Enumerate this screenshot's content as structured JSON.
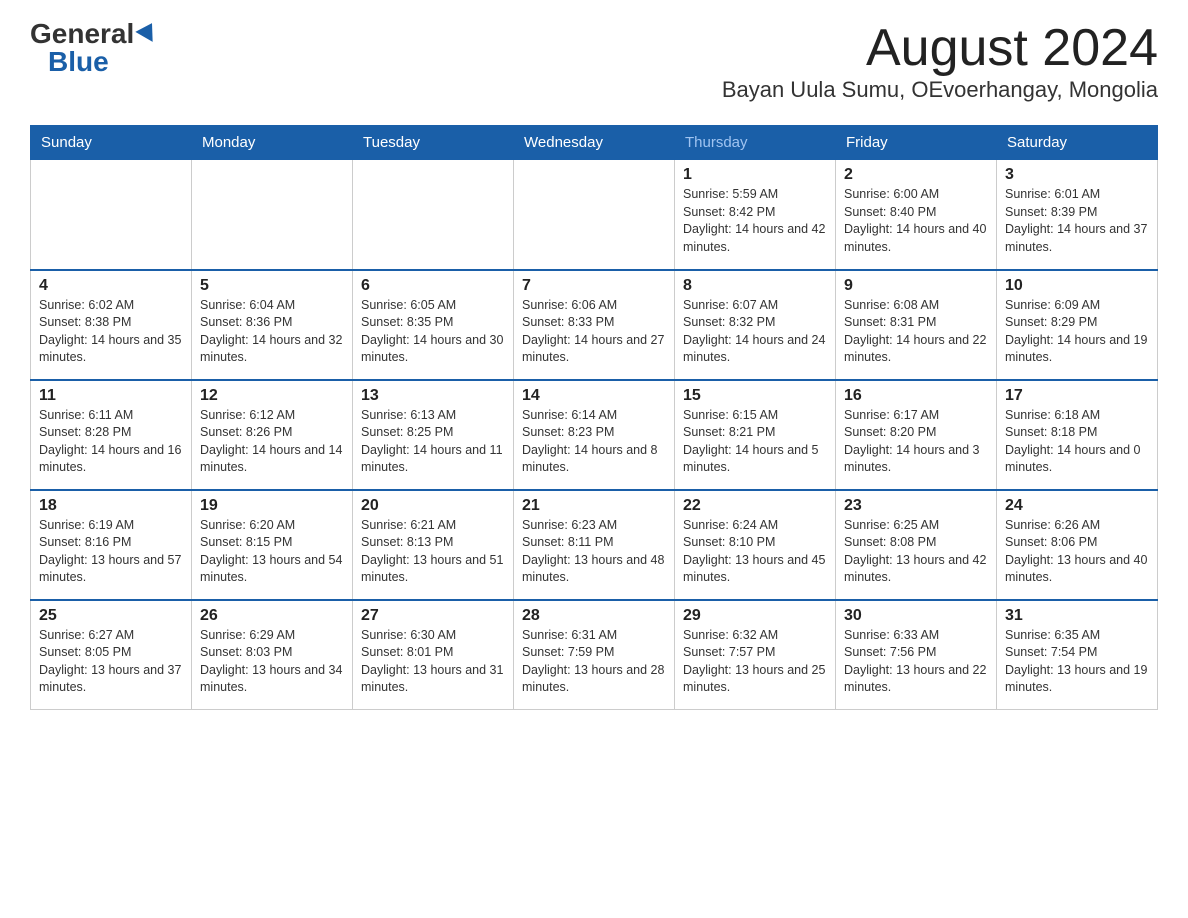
{
  "header": {
    "logo_general": "General",
    "logo_blue": "Blue",
    "month_title": "August 2024",
    "subtitle": "Bayan Uula Sumu, OEvoerhangay, Mongolia"
  },
  "days_of_week": [
    "Sunday",
    "Monday",
    "Tuesday",
    "Wednesday",
    "Thursday",
    "Friday",
    "Saturday"
  ],
  "weeks": [
    [
      {
        "day": "",
        "sunrise": "",
        "sunset": "",
        "daylight": ""
      },
      {
        "day": "",
        "sunrise": "",
        "sunset": "",
        "daylight": ""
      },
      {
        "day": "",
        "sunrise": "",
        "sunset": "",
        "daylight": ""
      },
      {
        "day": "",
        "sunrise": "",
        "sunset": "",
        "daylight": ""
      },
      {
        "day": "1",
        "sunrise": "Sunrise: 5:59 AM",
        "sunset": "Sunset: 8:42 PM",
        "daylight": "Daylight: 14 hours and 42 minutes."
      },
      {
        "day": "2",
        "sunrise": "Sunrise: 6:00 AM",
        "sunset": "Sunset: 8:40 PM",
        "daylight": "Daylight: 14 hours and 40 minutes."
      },
      {
        "day": "3",
        "sunrise": "Sunrise: 6:01 AM",
        "sunset": "Sunset: 8:39 PM",
        "daylight": "Daylight: 14 hours and 37 minutes."
      }
    ],
    [
      {
        "day": "4",
        "sunrise": "Sunrise: 6:02 AM",
        "sunset": "Sunset: 8:38 PM",
        "daylight": "Daylight: 14 hours and 35 minutes."
      },
      {
        "day": "5",
        "sunrise": "Sunrise: 6:04 AM",
        "sunset": "Sunset: 8:36 PM",
        "daylight": "Daylight: 14 hours and 32 minutes."
      },
      {
        "day": "6",
        "sunrise": "Sunrise: 6:05 AM",
        "sunset": "Sunset: 8:35 PM",
        "daylight": "Daylight: 14 hours and 30 minutes."
      },
      {
        "day": "7",
        "sunrise": "Sunrise: 6:06 AM",
        "sunset": "Sunset: 8:33 PM",
        "daylight": "Daylight: 14 hours and 27 minutes."
      },
      {
        "day": "8",
        "sunrise": "Sunrise: 6:07 AM",
        "sunset": "Sunset: 8:32 PM",
        "daylight": "Daylight: 14 hours and 24 minutes."
      },
      {
        "day": "9",
        "sunrise": "Sunrise: 6:08 AM",
        "sunset": "Sunset: 8:31 PM",
        "daylight": "Daylight: 14 hours and 22 minutes."
      },
      {
        "day": "10",
        "sunrise": "Sunrise: 6:09 AM",
        "sunset": "Sunset: 8:29 PM",
        "daylight": "Daylight: 14 hours and 19 minutes."
      }
    ],
    [
      {
        "day": "11",
        "sunrise": "Sunrise: 6:11 AM",
        "sunset": "Sunset: 8:28 PM",
        "daylight": "Daylight: 14 hours and 16 minutes."
      },
      {
        "day": "12",
        "sunrise": "Sunrise: 6:12 AM",
        "sunset": "Sunset: 8:26 PM",
        "daylight": "Daylight: 14 hours and 14 minutes."
      },
      {
        "day": "13",
        "sunrise": "Sunrise: 6:13 AM",
        "sunset": "Sunset: 8:25 PM",
        "daylight": "Daylight: 14 hours and 11 minutes."
      },
      {
        "day": "14",
        "sunrise": "Sunrise: 6:14 AM",
        "sunset": "Sunset: 8:23 PM",
        "daylight": "Daylight: 14 hours and 8 minutes."
      },
      {
        "day": "15",
        "sunrise": "Sunrise: 6:15 AM",
        "sunset": "Sunset: 8:21 PM",
        "daylight": "Daylight: 14 hours and 5 minutes."
      },
      {
        "day": "16",
        "sunrise": "Sunrise: 6:17 AM",
        "sunset": "Sunset: 8:20 PM",
        "daylight": "Daylight: 14 hours and 3 minutes."
      },
      {
        "day": "17",
        "sunrise": "Sunrise: 6:18 AM",
        "sunset": "Sunset: 8:18 PM",
        "daylight": "Daylight: 14 hours and 0 minutes."
      }
    ],
    [
      {
        "day": "18",
        "sunrise": "Sunrise: 6:19 AM",
        "sunset": "Sunset: 8:16 PM",
        "daylight": "Daylight: 13 hours and 57 minutes."
      },
      {
        "day": "19",
        "sunrise": "Sunrise: 6:20 AM",
        "sunset": "Sunset: 8:15 PM",
        "daylight": "Daylight: 13 hours and 54 minutes."
      },
      {
        "day": "20",
        "sunrise": "Sunrise: 6:21 AM",
        "sunset": "Sunset: 8:13 PM",
        "daylight": "Daylight: 13 hours and 51 minutes."
      },
      {
        "day": "21",
        "sunrise": "Sunrise: 6:23 AM",
        "sunset": "Sunset: 8:11 PM",
        "daylight": "Daylight: 13 hours and 48 minutes."
      },
      {
        "day": "22",
        "sunrise": "Sunrise: 6:24 AM",
        "sunset": "Sunset: 8:10 PM",
        "daylight": "Daylight: 13 hours and 45 minutes."
      },
      {
        "day": "23",
        "sunrise": "Sunrise: 6:25 AM",
        "sunset": "Sunset: 8:08 PM",
        "daylight": "Daylight: 13 hours and 42 minutes."
      },
      {
        "day": "24",
        "sunrise": "Sunrise: 6:26 AM",
        "sunset": "Sunset: 8:06 PM",
        "daylight": "Daylight: 13 hours and 40 minutes."
      }
    ],
    [
      {
        "day": "25",
        "sunrise": "Sunrise: 6:27 AM",
        "sunset": "Sunset: 8:05 PM",
        "daylight": "Daylight: 13 hours and 37 minutes."
      },
      {
        "day": "26",
        "sunrise": "Sunrise: 6:29 AM",
        "sunset": "Sunset: 8:03 PM",
        "daylight": "Daylight: 13 hours and 34 minutes."
      },
      {
        "day": "27",
        "sunrise": "Sunrise: 6:30 AM",
        "sunset": "Sunset: 8:01 PM",
        "daylight": "Daylight: 13 hours and 31 minutes."
      },
      {
        "day": "28",
        "sunrise": "Sunrise: 6:31 AM",
        "sunset": "Sunset: 7:59 PM",
        "daylight": "Daylight: 13 hours and 28 minutes."
      },
      {
        "day": "29",
        "sunrise": "Sunrise: 6:32 AM",
        "sunset": "Sunset: 7:57 PM",
        "daylight": "Daylight: 13 hours and 25 minutes."
      },
      {
        "day": "30",
        "sunrise": "Sunrise: 6:33 AM",
        "sunset": "Sunset: 7:56 PM",
        "daylight": "Daylight: 13 hours and 22 minutes."
      },
      {
        "day": "31",
        "sunrise": "Sunrise: 6:35 AM",
        "sunset": "Sunset: 7:54 PM",
        "daylight": "Daylight: 13 hours and 19 minutes."
      }
    ]
  ],
  "colors": {
    "header_bg": "#1a5fa8",
    "header_text": "#ffffff",
    "border": "#1a5fa8",
    "thu_color": "#1a5fa8"
  }
}
